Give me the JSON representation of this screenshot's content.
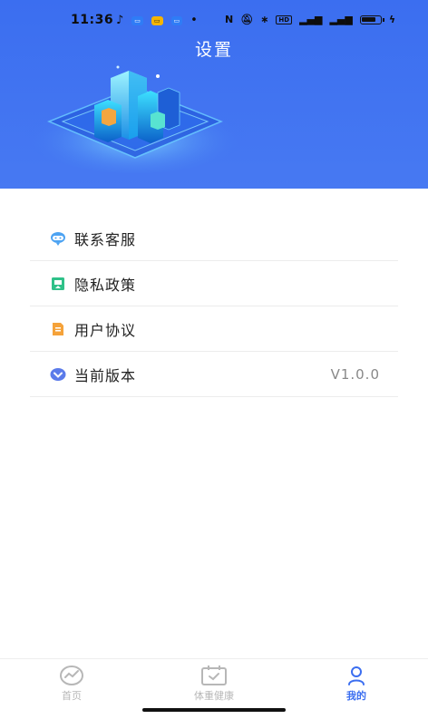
{
  "status_bar": {
    "time": "11:36",
    "right_text_1": "⁵⁵",
    "right_text_2": "⁴⁶",
    "hd_label": "HD"
  },
  "header": {
    "title": "设置"
  },
  "menu": {
    "items": [
      {
        "label": "联系客服",
        "icon": "customer-service-icon"
      },
      {
        "label": "隐私政策",
        "icon": "privacy-icon"
      },
      {
        "label": "用户协议",
        "icon": "user-agreement-icon"
      },
      {
        "label": "当前版本",
        "icon": "version-icon",
        "value": "V1.0.0"
      }
    ]
  },
  "tabbar": {
    "tabs": [
      {
        "label": "首页",
        "icon": "home-chart-icon",
        "active": false
      },
      {
        "label": "体重健康",
        "icon": "weight-health-icon",
        "active": false
      },
      {
        "label": "我的",
        "icon": "profile-icon",
        "active": true
      }
    ]
  },
  "colors": {
    "primary": "#3b6ef0",
    "header_gradient_end": "#4779f2",
    "tab_inactive": "#b7b7b7",
    "divider": "#ececec"
  }
}
